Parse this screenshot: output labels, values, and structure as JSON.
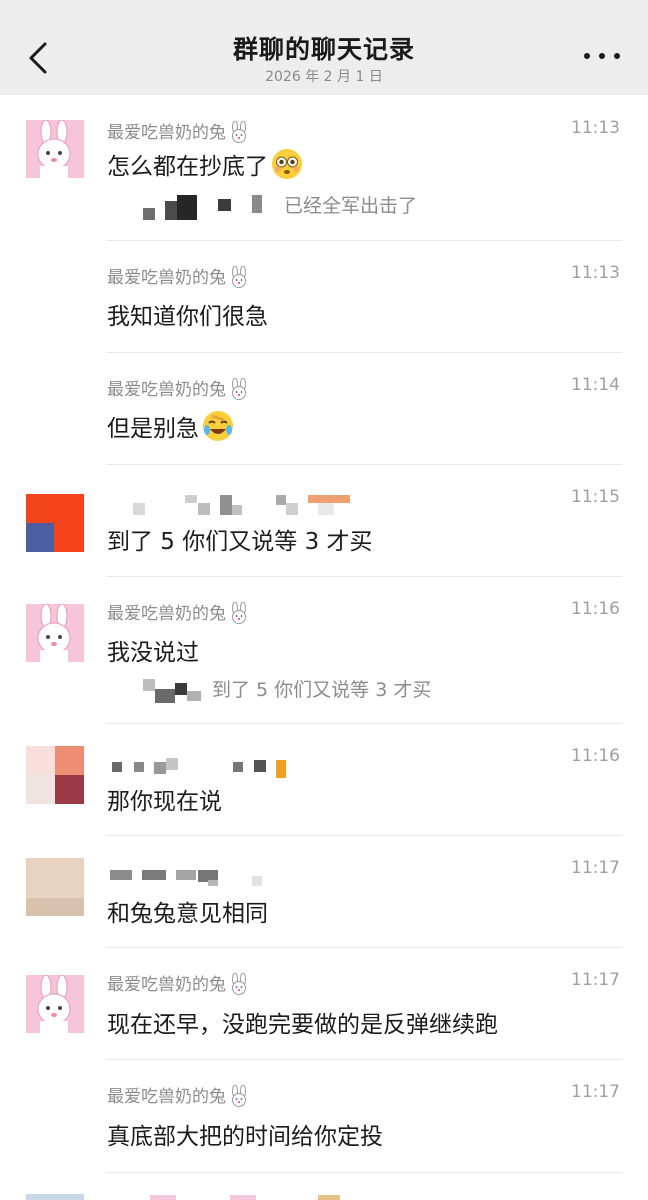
{
  "header": {
    "title": "群聊的聊天记录",
    "date": "2026 年 2 月 1 日",
    "back_icon": "chevron-left-icon",
    "more_icon": "more-dots-icon"
  },
  "messages": [
    {
      "sender": "最爱吃兽奶的兔",
      "time": "11:13",
      "text": "怎么都在抄底了",
      "emoji": "flushed-face-emoji",
      "quote": "已经全军出击了"
    },
    {
      "sender": "最爱吃兽奶的兔",
      "time": "11:13",
      "text": "我知道你们很急"
    },
    {
      "sender": "最爱吃兽奶的兔",
      "time": "11:14",
      "text": "但是别急",
      "emoji": "crying-laughing-emoji"
    },
    {
      "sender": "",
      "time": "11:15",
      "text": "到了 5 你们又说等 3 才买"
    },
    {
      "sender": "最爱吃兽奶的兔",
      "time": "11:16",
      "text": "我没说过",
      "quote": "到了 5 你们又说等 3 才买"
    },
    {
      "sender": "",
      "time": "11:16",
      "text": "那你现在说"
    },
    {
      "sender": "",
      "time": "11:17",
      "text": "和兔兔意见相同"
    },
    {
      "sender": "最爱吃兽奶的兔",
      "time": "11:17",
      "text": "现在还早，没跑完要做的是反弹继续跑"
    },
    {
      "sender": "最爱吃兽奶的兔",
      "time": "11:17",
      "text": "真底部大把的时间给你定投"
    }
  ]
}
